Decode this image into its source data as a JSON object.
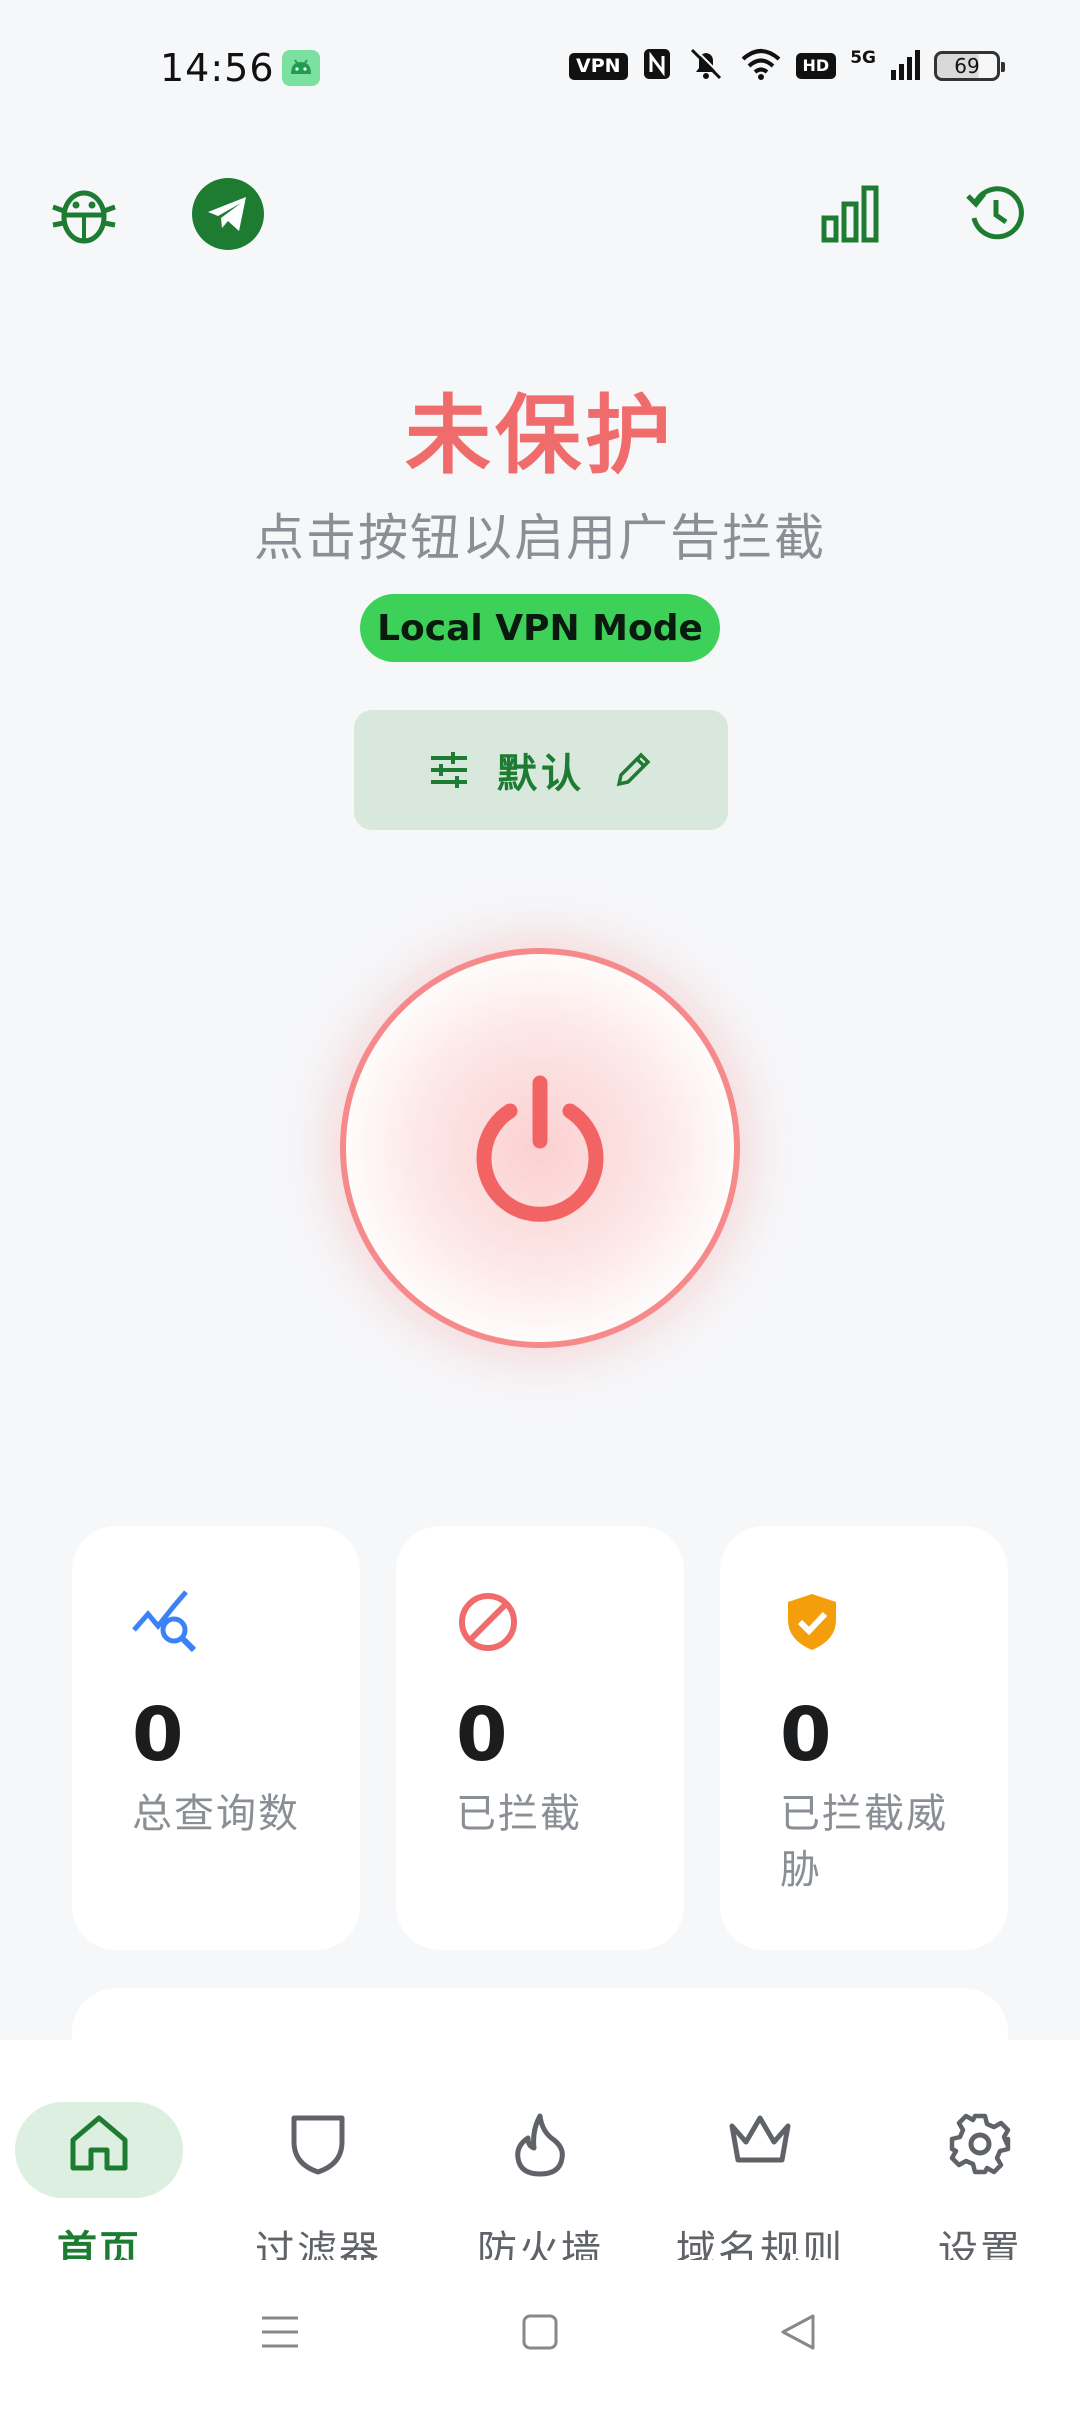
{
  "status_bar": {
    "time": "14:56",
    "vpn_badge": "VPN",
    "network_badge": "HD",
    "network_type": "5G",
    "battery_level": "69",
    "icons": [
      "android-app-icon",
      "vpn-icon",
      "nfc-icon",
      "mute-icon",
      "wifi-icon",
      "hd-icon",
      "signal-icon",
      "battery-icon"
    ]
  },
  "top_actions": {
    "left": [
      "bug-icon",
      "telegram-icon"
    ],
    "right": [
      "stats-icon",
      "history-icon"
    ]
  },
  "protection": {
    "title": "未保护",
    "subtitle": "点击按钮以启用广告拦截",
    "mode": "Local VPN Mode",
    "profile_label": "默认"
  },
  "stats": [
    {
      "icon": "query-search-icon",
      "value": "0",
      "label": "总查询数",
      "color": "#3b82f6"
    },
    {
      "icon": "block-icon",
      "value": "0",
      "label": "已拦截",
      "color": "#f06b6b"
    },
    {
      "icon": "shield-check-icon",
      "value": "0",
      "label": "已拦截威胁",
      "color": "#f59e0b"
    }
  ],
  "nav": {
    "items": [
      {
        "label": "首页",
        "icon": "home-icon",
        "active": true
      },
      {
        "label": "过滤器",
        "icon": "shield-icon",
        "active": false
      },
      {
        "label": "防火墙",
        "icon": "flame-icon",
        "active": false
      },
      {
        "label": "域名规则",
        "icon": "crown-icon",
        "active": false
      },
      {
        "label": "设置",
        "icon": "gear-icon",
        "active": false
      }
    ]
  },
  "colors": {
    "accent": "#1e7c32",
    "danger": "#f06b6b",
    "mode_pill": "#3dd15a"
  }
}
